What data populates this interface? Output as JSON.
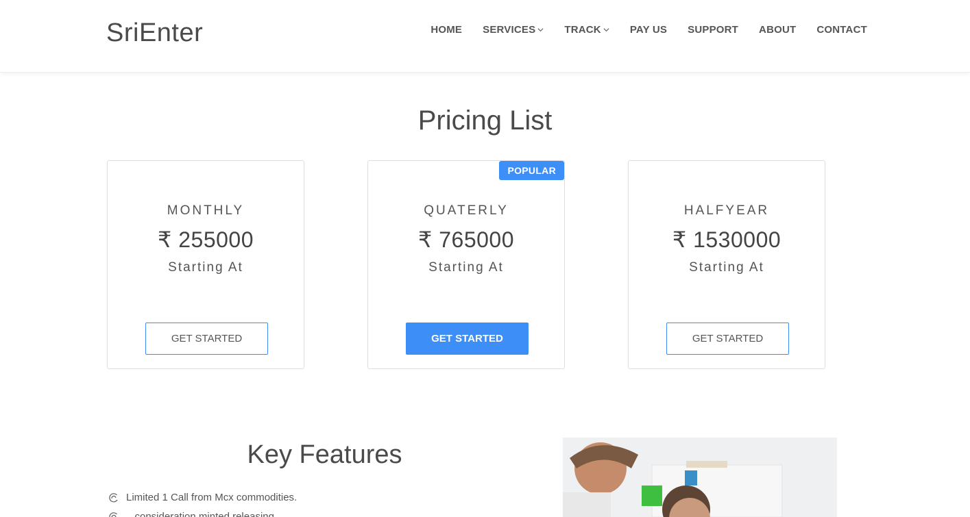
{
  "header": {
    "logo": "SriEnter",
    "nav": [
      {
        "label": "HOME",
        "dropdown": false
      },
      {
        "label": "SERVICES",
        "dropdown": true
      },
      {
        "label": "TRACK",
        "dropdown": true
      },
      {
        "label": "PAY US",
        "dropdown": false
      },
      {
        "label": "SUPPORT",
        "dropdown": false
      },
      {
        "label": "ABOUT",
        "dropdown": false
      },
      {
        "label": "CONTACT",
        "dropdown": false
      }
    ]
  },
  "pricing": {
    "title": "Pricing List",
    "plans": [
      {
        "name": "MONTHLY",
        "price": "₹ 255000",
        "sub": "Starting At",
        "button": "GET STARTED"
      },
      {
        "name": "QUATERLY",
        "price": "₹ 765000",
        "sub": "Starting At",
        "button": "GET STARTED",
        "badge": "POPULAR"
      },
      {
        "name": "HALFYEAR",
        "price": "₹ 1530000",
        "sub": "Starting At",
        "button": "GET STARTED"
      }
    ]
  },
  "features": {
    "title": "Key Features",
    "items": [
      "Limited 1 Call from Mcx commodities.",
      "...consideration minted releasing..."
    ]
  },
  "colors": {
    "accent": "#3e8ef7",
    "text": "#444444"
  }
}
